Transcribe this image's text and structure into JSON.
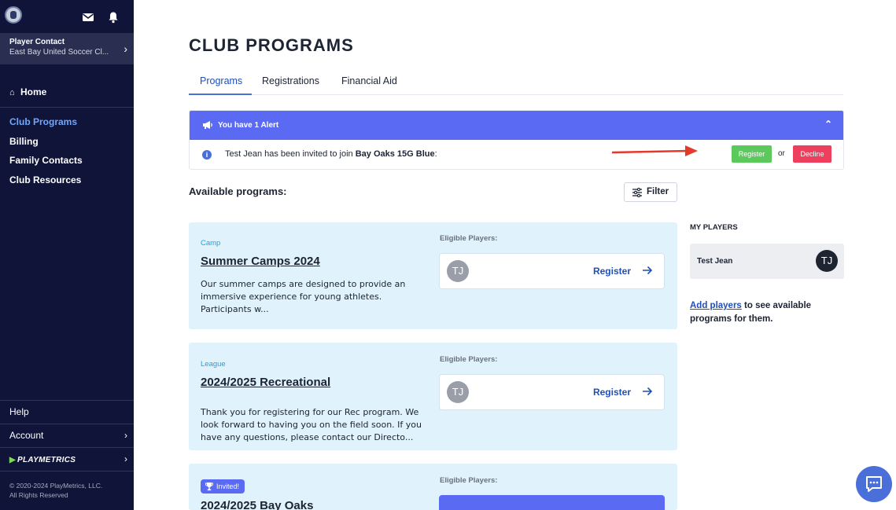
{
  "sidebar": {
    "contact_title": "Player Contact",
    "contact_club": "East Bay United Soccer Cl...",
    "home": "Home",
    "nav": [
      "Club Programs",
      "Billing",
      "Family Contacts",
      "Club Resources"
    ],
    "help": "Help",
    "account": "Account",
    "brand": "PLAYMETRICS",
    "copyright_line1": "© 2020-2024 PlayMetrics, LLC.",
    "copyright_line2": "All Rights Reserved"
  },
  "page": {
    "title": "CLUB PROGRAMS",
    "tabs": [
      "Programs",
      "Registrations",
      "Financial Aid"
    ]
  },
  "alert": {
    "header": "You have 1 Alert",
    "message_prefix": "Test Jean has been invited to join ",
    "message_team": "Bay Oaks 15G Blue",
    "message_suffix": ":",
    "register_label": "Register",
    "or_label": "or",
    "decline_label": "Decline"
  },
  "programs": {
    "heading": "Available programs:",
    "filter_label": "Filter",
    "eligible_label": "Eligible Players:",
    "register_label": "Register",
    "player_initials": "TJ",
    "cards": [
      {
        "category": "Camp",
        "title": "Summer Camps 2024",
        "description": "Our summer camps are designed to provide an immersive experience for young athletes. Participants w..."
      },
      {
        "category": "League",
        "title": "2024/2025 Recreational",
        "description": "Thank you for registering for our Rec program. We look forward to having you on the field soon. If you have any questions, please contact our Directo..."
      },
      {
        "badge": "Invited!",
        "title": "2024/2025 Bay Oaks"
      }
    ]
  },
  "my_players": {
    "heading": "MY PLAYERS",
    "players": [
      {
        "name": "Test Jean",
        "initials": "TJ"
      }
    ],
    "add_link": "Add players",
    "add_suffix": " to see available programs for them."
  },
  "colors": {
    "sidebar_bg": "#0f1438",
    "accent": "#5b6af2",
    "register_green": "#5cc95d",
    "decline_red": "#ef3f5e",
    "card_bg": "#e0f2fb",
    "annotation_arrow": "#e5392b"
  },
  "icons": [
    "org-logo-icon",
    "mail-icon",
    "bell-icon",
    "chevron-right-icon",
    "home-icon",
    "megaphone-icon",
    "chevron-up-icon",
    "info-icon",
    "filter-icon",
    "arrow-right-icon",
    "trophy-icon",
    "chat-icon"
  ]
}
